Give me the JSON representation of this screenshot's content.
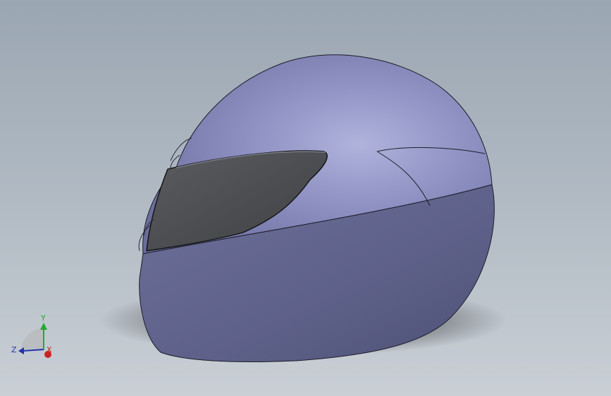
{
  "viewport": {
    "background_top": "#9aa6b2",
    "background_bottom": "#c9cfd5"
  },
  "model": {
    "shell_color": "#6c6f9e",
    "shell_highlight": "#a3a7d4",
    "visor_color": "#4d4f52"
  },
  "triad": {
    "y_label": "Y",
    "z_label": "Z",
    "x_label": "X",
    "y_color": "#22aa33",
    "z_color": "#2233aa",
    "x_color": "#cc2222"
  }
}
